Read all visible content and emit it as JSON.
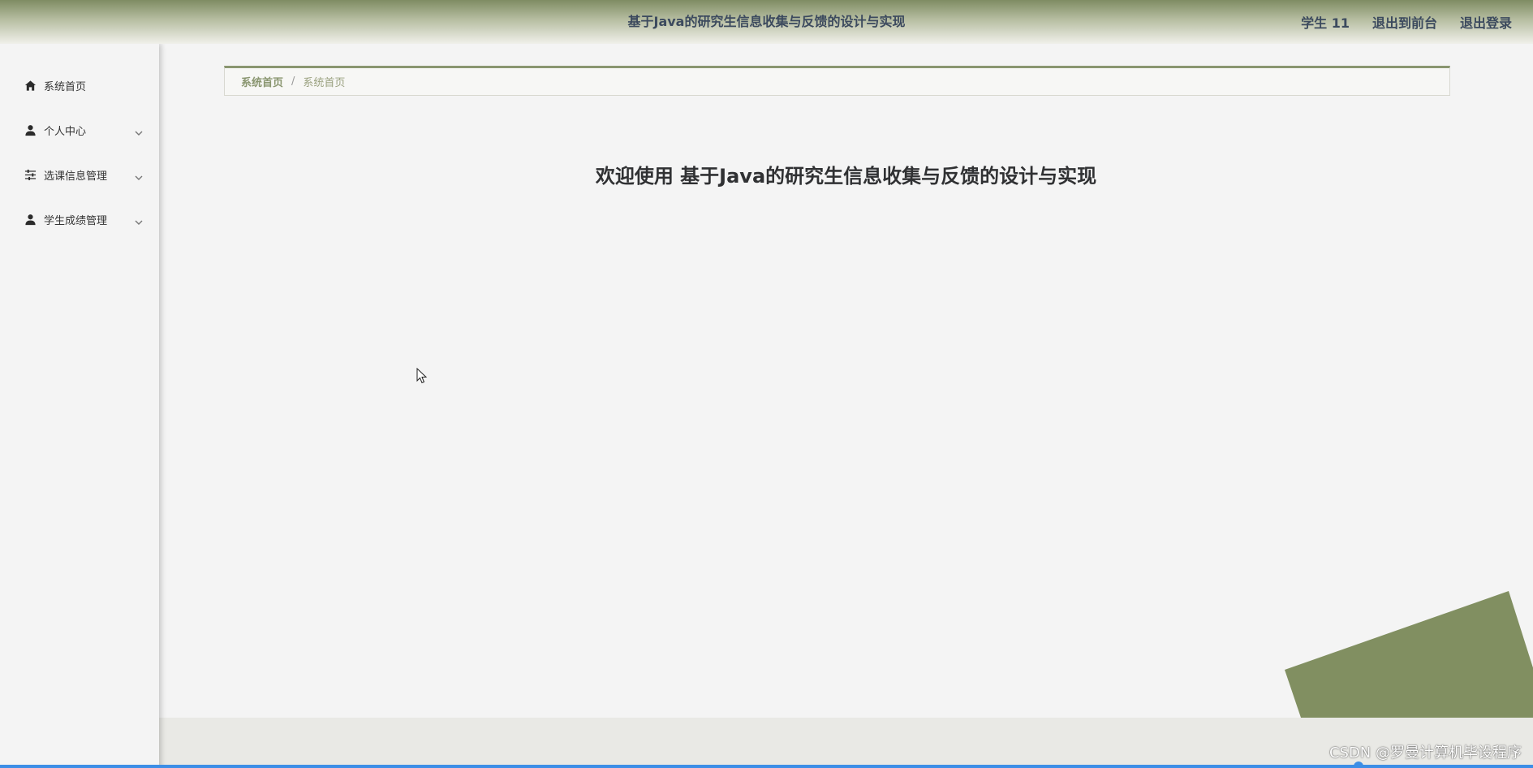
{
  "header": {
    "title": "基于Java的研究生信息收集与反馈的设计与实现",
    "user_label": "学生 11",
    "to_front_label": "退出到前台",
    "logout_label": "退出登录"
  },
  "sidebar": {
    "items": [
      {
        "label": "系统首页",
        "icon": "home-icon"
      },
      {
        "label": "个人中心",
        "icon": "user-icon"
      },
      {
        "label": "选课信息管理",
        "icon": "sliders-icon"
      },
      {
        "label": "学生成绩管理",
        "icon": "user-icon"
      }
    ]
  },
  "breadcrumb": {
    "home": "系统首页",
    "separator": "/",
    "current": "系统首页"
  },
  "main": {
    "welcome": "欢迎使用 基于Java的研究生信息收集与反馈的设计与实现"
  },
  "watermark": "CSDN @罗曼计算机毕设程序",
  "colors": {
    "accent": "#8a9670",
    "decoration": "#818f61",
    "header_text": "#3c4a5e",
    "bottom_bar": "#3d8ee6"
  }
}
